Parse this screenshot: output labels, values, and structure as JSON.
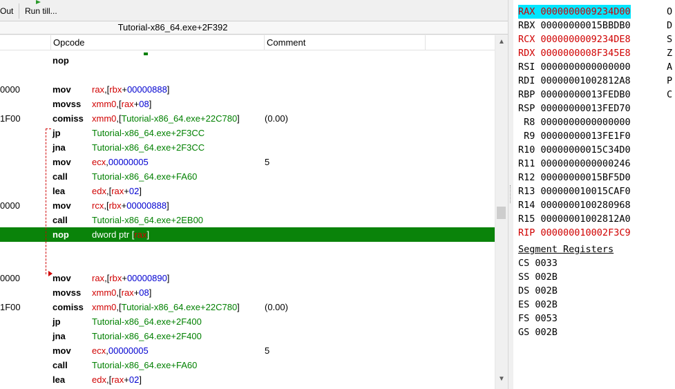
{
  "toolbar": {
    "step_out_label": "Out",
    "run_till_label": "Run till..."
  },
  "disassembler": {
    "title": "Tutorial-x86_64.exe+2F392",
    "columns": [
      "Opcode",
      "Comment"
    ],
    "rows": [
      {
        "addr": "",
        "op": "nop",
        "args": [],
        "comment": ""
      },
      {
        "addr": "",
        "op": "",
        "args": [],
        "comment": ""
      },
      {
        "addr": "0000",
        "op": "mov",
        "args": [
          [
            "reg",
            "rax"
          ],
          [
            "plain",
            ",["
          ],
          [
            "reg",
            "rbx"
          ],
          [
            "plain",
            "+"
          ],
          [
            "num",
            "00000888"
          ],
          [
            "plain",
            "]"
          ]
        ],
        "comment": ""
      },
      {
        "addr": "",
        "op": "movss",
        "args": [
          [
            "reg",
            "xmm0"
          ],
          [
            "plain",
            ",["
          ],
          [
            "reg",
            "rax"
          ],
          [
            "plain",
            "+"
          ],
          [
            "num",
            "08"
          ],
          [
            "plain",
            "]"
          ]
        ],
        "comment": ""
      },
      {
        "addr": "1F00",
        "op": "comiss",
        "args": [
          [
            "reg",
            "xmm0"
          ],
          [
            "plain",
            ",["
          ],
          [
            "sym",
            "Tutorial-x86_64.exe+22C780"
          ],
          [
            "plain",
            "]"
          ]
        ],
        "comment": "(0.00)"
      },
      {
        "addr": "",
        "op": "jp",
        "args": [
          [
            "sym",
            "Tutorial-x86_64.exe+2F3CC"
          ]
        ],
        "comment": ""
      },
      {
        "addr": "",
        "op": "jna",
        "args": [
          [
            "sym",
            "Tutorial-x86_64.exe+2F3CC"
          ]
        ],
        "comment": ""
      },
      {
        "addr": "",
        "op": "mov",
        "args": [
          [
            "reg",
            "ecx"
          ],
          [
            "plain",
            ","
          ],
          [
            "num",
            "00000005"
          ]
        ],
        "comment": "5"
      },
      {
        "addr": "",
        "op": "call",
        "args": [
          [
            "sym",
            "Tutorial-x86_64.exe+FA60"
          ]
        ],
        "comment": ""
      },
      {
        "addr": "",
        "op": "lea",
        "args": [
          [
            "reg",
            "edx"
          ],
          [
            "plain",
            ",["
          ],
          [
            "reg",
            "rax"
          ],
          [
            "plain",
            "+"
          ],
          [
            "num",
            "02"
          ],
          [
            "plain",
            "]"
          ]
        ],
        "comment": ""
      },
      {
        "addr": "0000",
        "op": "mov",
        "args": [
          [
            "reg",
            "rcx"
          ],
          [
            "plain",
            ",["
          ],
          [
            "reg",
            "rbx"
          ],
          [
            "plain",
            "+"
          ],
          [
            "num",
            "00000888"
          ],
          [
            "plain",
            "]"
          ]
        ],
        "comment": ""
      },
      {
        "addr": "",
        "op": "call",
        "args": [
          [
            "sym",
            "Tutorial-x86_64.exe+2EB00"
          ]
        ],
        "comment": ""
      },
      {
        "addr": "",
        "op": "nop",
        "args": [
          [
            "plain",
            "dword ptr ["
          ],
          [
            "reg",
            "rax"
          ],
          [
            "plain",
            "]"
          ]
        ],
        "comment": "",
        "selected": true
      },
      {
        "addr": "",
        "op": "",
        "args": [],
        "comment": ""
      },
      {
        "addr": "",
        "op": "",
        "args": [],
        "comment": ""
      },
      {
        "addr": "0000",
        "op": "mov",
        "args": [
          [
            "reg",
            "rax"
          ],
          [
            "plain",
            ",["
          ],
          [
            "reg",
            "rbx"
          ],
          [
            "plain",
            "+"
          ],
          [
            "num",
            "00000890"
          ],
          [
            "plain",
            "]"
          ]
        ],
        "comment": ""
      },
      {
        "addr": "",
        "op": "movss",
        "args": [
          [
            "reg",
            "xmm0"
          ],
          [
            "plain",
            ",["
          ],
          [
            "reg",
            "rax"
          ],
          [
            "plain",
            "+"
          ],
          [
            "num",
            "08"
          ],
          [
            "plain",
            "]"
          ]
        ],
        "comment": ""
      },
      {
        "addr": "1F00",
        "op": "comiss",
        "args": [
          [
            "reg",
            "xmm0"
          ],
          [
            "plain",
            ",["
          ],
          [
            "sym",
            "Tutorial-x86_64.exe+22C780"
          ],
          [
            "plain",
            "]"
          ]
        ],
        "comment": "(0.00)"
      },
      {
        "addr": "",
        "op": "jp",
        "args": [
          [
            "sym",
            "Tutorial-x86_64.exe+2F400"
          ]
        ],
        "comment": ""
      },
      {
        "addr": "",
        "op": "jna",
        "args": [
          [
            "sym",
            "Tutorial-x86_64.exe+2F400"
          ]
        ],
        "comment": ""
      },
      {
        "addr": "",
        "op": "mov",
        "args": [
          [
            "reg",
            "ecx"
          ],
          [
            "plain",
            ","
          ],
          [
            "num",
            "00000005"
          ]
        ],
        "comment": "5"
      },
      {
        "addr": "",
        "op": "call",
        "args": [
          [
            "sym",
            "Tutorial-x86_64.exe+FA60"
          ]
        ],
        "comment": ""
      },
      {
        "addr": "",
        "op": "lea",
        "args": [
          [
            "reg",
            "edx"
          ],
          [
            "plain",
            ",["
          ],
          [
            "reg",
            "rax"
          ],
          [
            "plain",
            "+"
          ],
          [
            "num",
            "02"
          ],
          [
            "plain",
            "]"
          ]
        ],
        "comment": ""
      }
    ]
  },
  "registers": {
    "general": [
      {
        "name": "RAX",
        "value": "0000000009234D00",
        "state": "highlight"
      },
      {
        "name": "RBX",
        "value": "00000000015BBDB0",
        "state": "normal"
      },
      {
        "name": "RCX",
        "value": "0000000009234DE8",
        "state": "changed"
      },
      {
        "name": "RDX",
        "value": "0000000008F345E8",
        "state": "changed"
      },
      {
        "name": "RSI",
        "value": "0000000000000000",
        "state": "normal"
      },
      {
        "name": "RDI",
        "value": "00000001002812A8",
        "state": "normal"
      },
      {
        "name": "RBP",
        "value": "00000000013FEDB0",
        "state": "normal"
      },
      {
        "name": "RSP",
        "value": "00000000013FED70",
        "state": "normal"
      },
      {
        "name": " R8",
        "value": "0000000000000000",
        "state": "normal"
      },
      {
        "name": " R9",
        "value": "00000000013FE1F0",
        "state": "normal"
      },
      {
        "name": "R10",
        "value": "00000000015C34D0",
        "state": "normal"
      },
      {
        "name": "R11",
        "value": "0000000000000246",
        "state": "normal"
      },
      {
        "name": "R12",
        "value": "00000000015BF5D0",
        "state": "normal"
      },
      {
        "name": "R13",
        "value": "000000010015CAF0",
        "state": "normal"
      },
      {
        "name": "R14",
        "value": "0000000100280968",
        "state": "normal"
      },
      {
        "name": "R15",
        "value": "00000001002812A0",
        "state": "normal"
      },
      {
        "name": "RIP",
        "value": "000000010002F3C9",
        "state": "changed"
      }
    ],
    "segment_title": "Segment Registers",
    "segment": [
      {
        "name": "CS",
        "value": "0033"
      },
      {
        "name": "SS",
        "value": "002B"
      },
      {
        "name": "DS",
        "value": "002B"
      },
      {
        "name": "ES",
        "value": "002B"
      },
      {
        "name": "FS",
        "value": "0053"
      },
      {
        "name": "GS",
        "value": "002B"
      }
    ],
    "flags": [
      "O",
      "D",
      "S",
      "Z",
      "A",
      "P",
      "C"
    ]
  },
  "colors": {
    "selected_row": "#0a830a",
    "register": "#d00000",
    "number": "#0000d0",
    "symbol": "#008000",
    "rax_highlight": "#00e5ff"
  }
}
